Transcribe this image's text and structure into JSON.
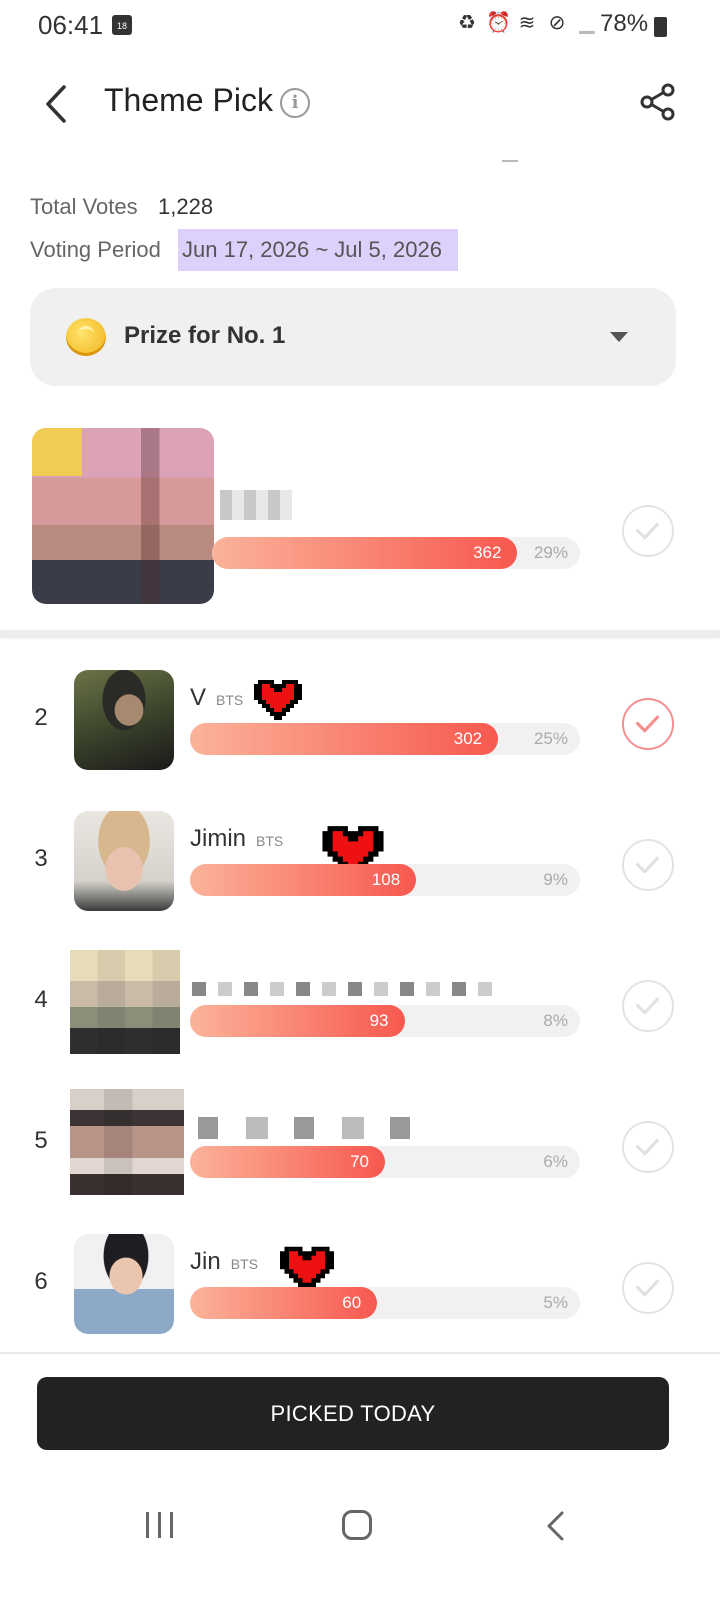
{
  "status_bar": {
    "time": "06:41",
    "calendar_day": "18",
    "battery": "78%",
    "icons": [
      "recycle-icon",
      "alarm-icon",
      "wifi-icon",
      "blocked-icon",
      "signal-icon"
    ]
  },
  "header": {
    "title": "Theme Pick",
    "info_glyph": "i"
  },
  "vote_info": {
    "total_label": "Total Votes",
    "total_value": "1,228",
    "period_label": "Voting Period",
    "period_value": "Jun 17, 2026 ~ Jul 5, 2026",
    "period_highlight_color": "#ddd0fb"
  },
  "prize": {
    "label": "Prize for No. 1"
  },
  "first_place": {
    "votes": "362",
    "percent": "29%",
    "share": 0.83
  },
  "ranking": [
    {
      "rank": "2",
      "name": "V",
      "group": "BTS",
      "votes": "302",
      "percent": "25%",
      "share": 0.79,
      "selected": true,
      "has_heart": true
    },
    {
      "rank": "3",
      "name": "Jimin",
      "group": "BTS",
      "votes": "108",
      "percent": "9%",
      "share": 0.58,
      "selected": false,
      "has_heart": true
    },
    {
      "rank": "4",
      "name": "",
      "group": "",
      "votes": "93",
      "percent": "8%",
      "share": 0.55,
      "selected": false,
      "has_heart": false
    },
    {
      "rank": "5",
      "name": "",
      "group": "",
      "votes": "70",
      "percent": "6%",
      "share": 0.5,
      "selected": false,
      "has_heart": false
    },
    {
      "rank": "6",
      "name": "Jin",
      "group": "BTS",
      "votes": "60",
      "percent": "5%",
      "share": 0.48,
      "selected": false,
      "has_heart": true
    }
  ],
  "bottom": {
    "button_label": "PICKED TODAY"
  },
  "colors": {
    "bar_start": "#fbb39a",
    "bar_end": "#f7584f",
    "selected_check": "#f78f8f",
    "button_bg": "#222222"
  }
}
